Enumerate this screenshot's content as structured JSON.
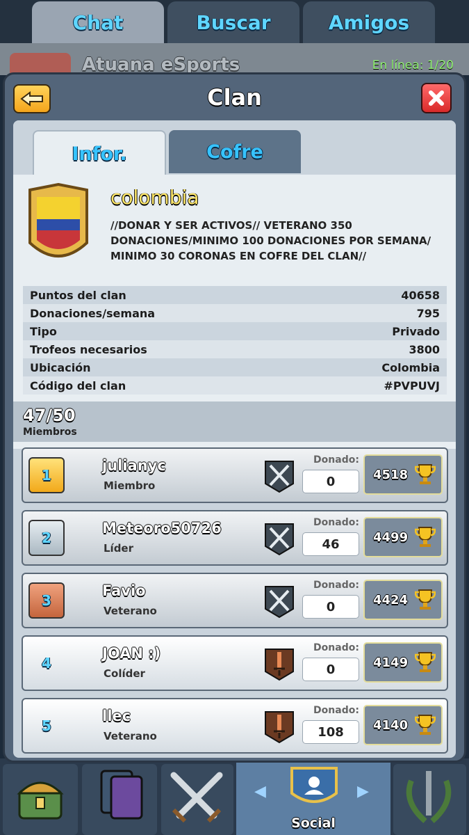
{
  "background": {
    "top_tabs": [
      "Chat",
      "Buscar",
      "Amigos"
    ],
    "clan_bar_name": "Atuana eSports",
    "online": "En línea: 1/20",
    "nav_social_label": "Social"
  },
  "modal": {
    "title": "Clan",
    "tabs": [
      "Infor.",
      "Cofre"
    ]
  },
  "clan": {
    "name": "colombia",
    "description": "//DONAR Y SER ACTIVOS// VETERANO 350 DONACIONES/MINIMO 100 DONACIONES POR SEMANA/ MINIMO 30 CORONAS EN COFRE DEL CLAN//",
    "stats": [
      {
        "label": "Puntos del clan",
        "value": "40658"
      },
      {
        "label": "Donaciones/semana",
        "value": "795"
      },
      {
        "label": "Tipo",
        "value": "Privado"
      },
      {
        "label": "Trofeos necesarios",
        "value": "3800"
      },
      {
        "label": "Ubicación",
        "value": "Colombia"
      },
      {
        "label": "Código del clan",
        "value": "#PVPUVJ"
      }
    ],
    "members_count": "47/50",
    "members_label": "Miembros"
  },
  "donated_label": "Donado:",
  "members": [
    {
      "rank": "1",
      "name": "julianyc",
      "role": "Miembro",
      "donated": "0",
      "trophies": "4518",
      "rank_style": "gold",
      "arena": "swords"
    },
    {
      "rank": "2",
      "name": "Meteoro50726",
      "role": "Líder",
      "donated": "46",
      "trophies": "4499",
      "rank_style": "silver",
      "arena": "swords"
    },
    {
      "rank": "3",
      "name": "Favio",
      "role": "Veterano",
      "donated": "0",
      "trophies": "4424",
      "rank_style": "bronze",
      "arena": "swords"
    },
    {
      "rank": "4",
      "name": "JOAN :)",
      "role": "Colíder",
      "donated": "0",
      "trophies": "4149",
      "rank_style": "plain",
      "arena": "sword"
    },
    {
      "rank": "5",
      "name": "llec",
      "role": "Veterano",
      "donated": "108",
      "trophies": "4140",
      "rank_style": "plain",
      "arena": "sword"
    }
  ],
  "colors": {
    "accent_blue": "#36c3ff",
    "clan_name_yellow": "#ffe86a",
    "close_red": "#d92a2a",
    "back_yellow": "#f4a51c"
  }
}
